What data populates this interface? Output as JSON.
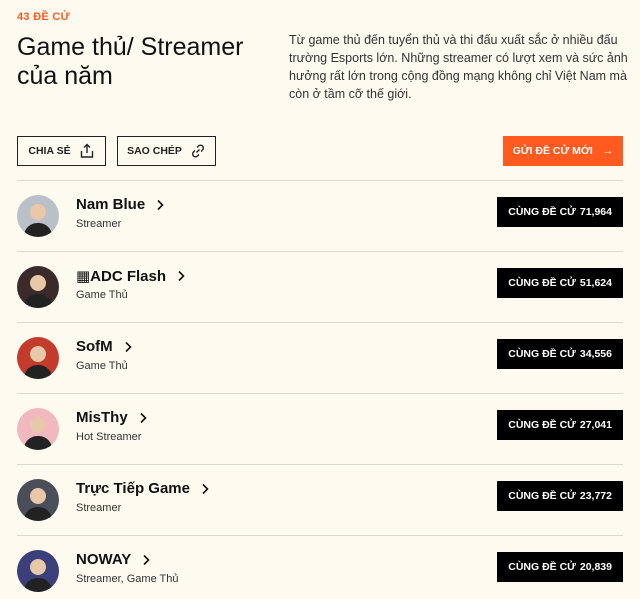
{
  "header": {
    "count_label": "43 ĐỀ CỬ",
    "title": "Game thủ/ Streamer của năm",
    "description": "Từ game thủ đến tuyển thủ và thi đấu xuất sắc ở nhiều đấu trường Esports lớn. Những streamer có lượt xem và sức ảnh hưởng rất lớn trong cộng đồng mạng không chỉ Việt Nam mà còn ở tầm cỡ thế giới."
  },
  "actions": {
    "share_label": "CHIA SẺ",
    "copy_label": "SAO CHÉP",
    "submit_label": "GỬI ĐỀ CỬ MỚI",
    "submit_arrow": "→"
  },
  "vote_label": "CÙNG ĐỀ CỬ",
  "nominees": [
    {
      "name": "Nam Blue",
      "role": "Streamer",
      "votes": "71,964",
      "avatar_color": "#b9c0c8"
    },
    {
      "name": "▦ADC Flash",
      "role": "Game Thủ",
      "votes": "51,624",
      "avatar_color": "#3a2a2a"
    },
    {
      "name": "SofM",
      "role": "Game Thủ",
      "votes": "34,556",
      "avatar_color": "#c23b2c"
    },
    {
      "name": "MisThy",
      "role": "Hot Streamer",
      "votes": "27,041",
      "avatar_color": "#f2b8c0"
    },
    {
      "name": "Trực Tiếp Game",
      "role": "Streamer",
      "votes": "23,772",
      "avatar_color": "#4a4e58"
    },
    {
      "name": "NOWAY",
      "role": "Streamer, Game Thủ",
      "votes": "20,839",
      "avatar_color": "#3b3f7a"
    }
  ]
}
